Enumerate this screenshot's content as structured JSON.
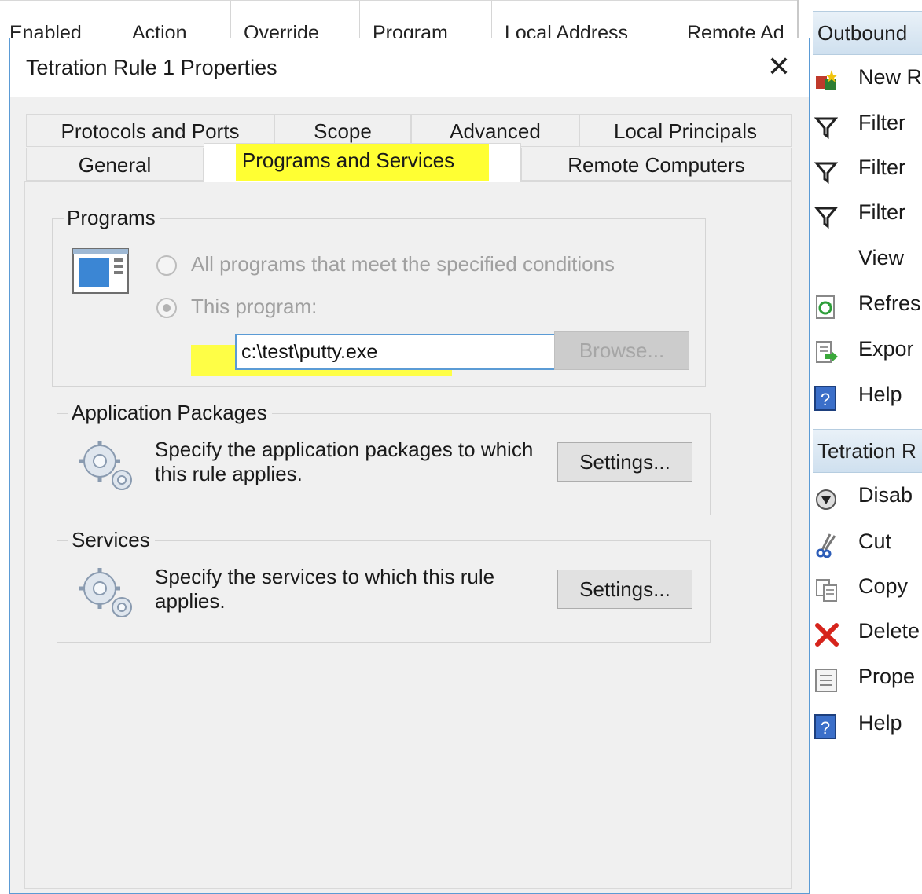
{
  "background_table": {
    "columns": [
      "Enabled",
      "Action",
      "Override",
      "Program",
      "Local Address",
      "Remote Ad"
    ]
  },
  "actions_pane": {
    "section1_header": "Outbound",
    "section1_items": [
      {
        "label": "New R",
        "icon": "new-rule-icon"
      },
      {
        "label": "Filter",
        "icon": "filter-icon"
      },
      {
        "label": "Filter",
        "icon": "filter-icon"
      },
      {
        "label": "Filter",
        "icon": "filter-icon"
      },
      {
        "label": "View",
        "icon": "none"
      },
      {
        "label": "Refres",
        "icon": "refresh-icon"
      },
      {
        "label": "Expor",
        "icon": "export-icon"
      },
      {
        "label": "Help",
        "icon": "help-icon"
      }
    ],
    "section2_header": "Tetration R",
    "section2_items": [
      {
        "label": "Disab",
        "icon": "disable-icon"
      },
      {
        "label": "Cut",
        "icon": "cut-icon"
      },
      {
        "label": "Copy",
        "icon": "copy-icon"
      },
      {
        "label": "Delete",
        "icon": "delete-icon"
      },
      {
        "label": "Prope",
        "icon": "properties-icon"
      },
      {
        "label": "Help",
        "icon": "help-icon"
      }
    ]
  },
  "dialog": {
    "title": "Tetration Rule 1 Properties",
    "close_glyph": "✕",
    "tabs_row1": [
      "Protocols and Ports",
      "Scope",
      "Advanced",
      "Local Principals"
    ],
    "tabs_row2": [
      "General",
      "Programs and Services",
      "Remote Computers"
    ],
    "active_tab": "Programs and Services",
    "programs": {
      "group_label": "Programs",
      "radio_all": "All programs that meet the specified conditions",
      "radio_this": "This program:",
      "selected": "This program:",
      "path_value": "c:\\test\\putty.exe",
      "browse_label": "Browse..."
    },
    "app_packages": {
      "group_label": "Application Packages",
      "description": "Specify the application packages to which this rule applies.",
      "settings_label": "Settings..."
    },
    "services": {
      "group_label": "Services",
      "description": "Specify the services to which this rule applies.",
      "settings_label": "Settings..."
    }
  },
  "colors": {
    "highlight": "#ffff33",
    "focus_border": "#5b9bd5",
    "dialog_bg": "#f0f0f0"
  }
}
